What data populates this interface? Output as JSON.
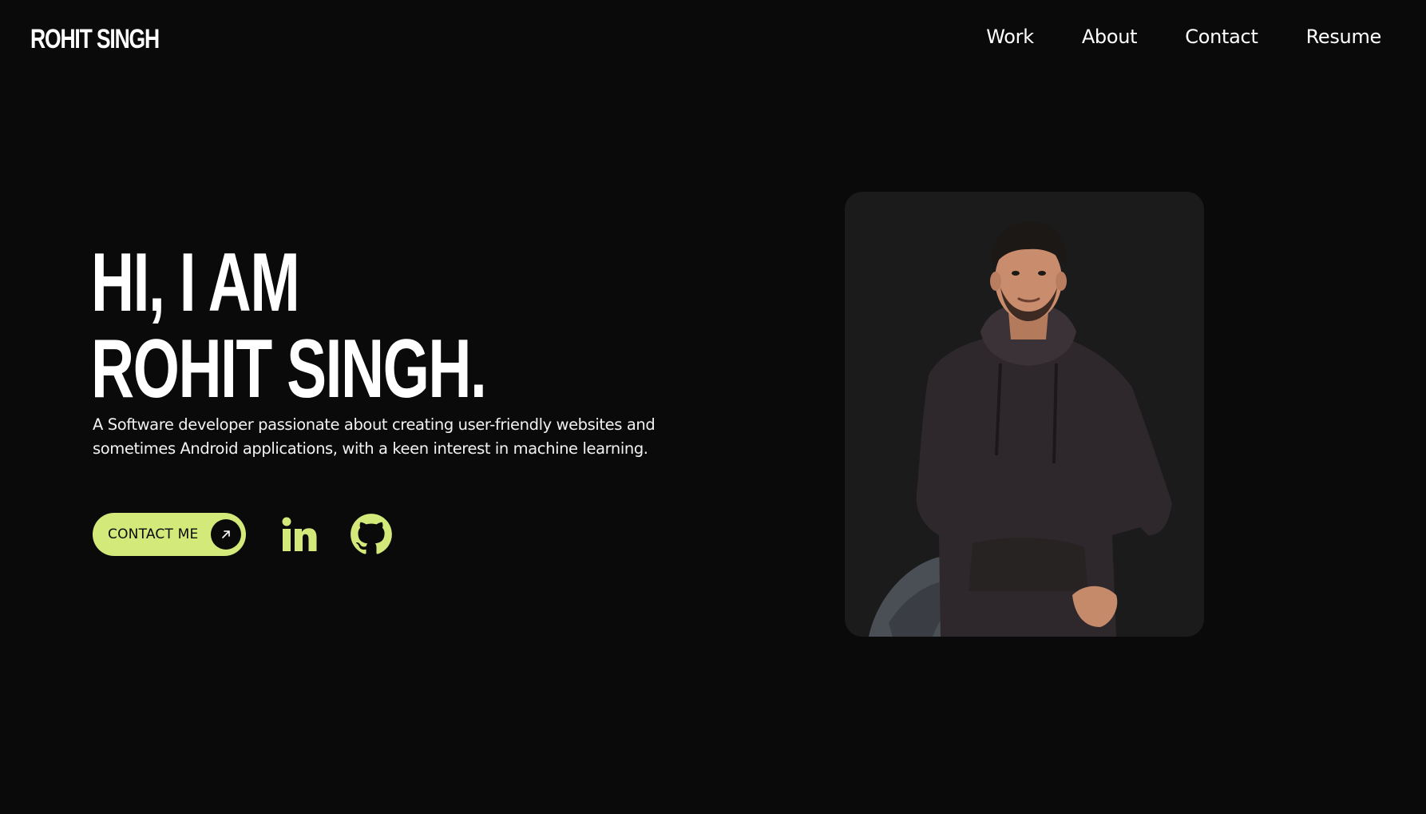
{
  "header": {
    "logo": "ROHIT SINGH",
    "nav": [
      {
        "label": "Work"
      },
      {
        "label": "About"
      },
      {
        "label": "Contact"
      },
      {
        "label": "Resume"
      }
    ]
  },
  "hero": {
    "title_line1": "HI, I AM",
    "title_line2": "ROHIT SINGH.",
    "description": "A Software developer passionate about creating user-friendly websites and sometimes Android applications, with a keen interest in machine learning."
  },
  "actions": {
    "contact_label": "CONTACT ME",
    "contact_icon": "arrow-up-right-icon",
    "social": [
      {
        "icon": "linkedin-icon"
      },
      {
        "icon": "github-icon"
      }
    ]
  },
  "photo": {
    "subject": "portrait-photo"
  },
  "colors": {
    "background": "#0a0a0a",
    "accent": "#d3e97a",
    "card": "#1b1b1b",
    "text": "#ffffff"
  }
}
